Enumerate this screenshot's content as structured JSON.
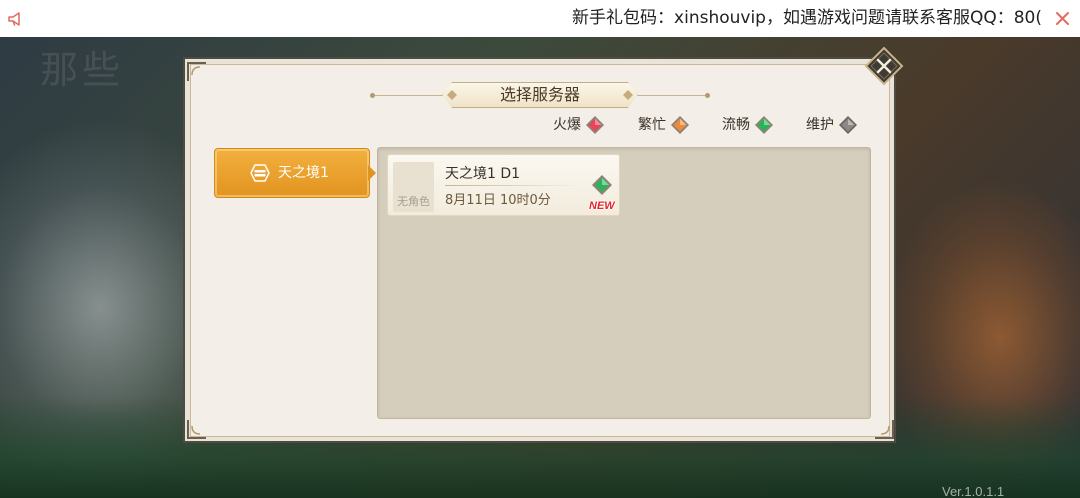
{
  "notice": {
    "text": "新手礼包码：xinshouvip，如遇游戏问题请联系客服QQ：80("
  },
  "background": {
    "logo_text": "那些",
    "version": "Ver.1.0.1.1"
  },
  "dialog": {
    "title": "选择服务器",
    "legend": [
      {
        "label": "火爆",
        "color": "#e8445a"
      },
      {
        "label": "繁忙",
        "color": "#f08a3a"
      },
      {
        "label": "流畅",
        "color": "#2bb35a"
      },
      {
        "label": "维护",
        "color": "#8a8a8a"
      }
    ],
    "server_group": {
      "label": "天之境1"
    },
    "servers": [
      {
        "name": "天之境1 D1",
        "time": "8月11日 10时0分",
        "avatar_label": "无角色",
        "status_color": "#2bb35a",
        "badge": "NEW"
      }
    ]
  }
}
